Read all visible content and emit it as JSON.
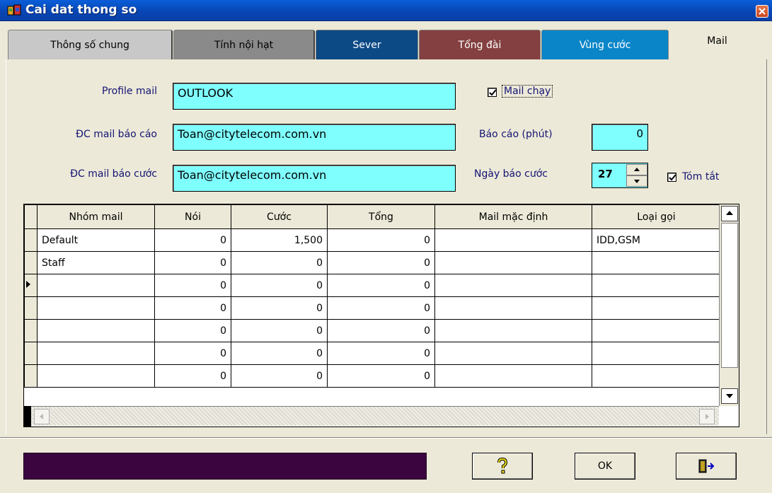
{
  "window": {
    "title": "Cai dat thong so"
  },
  "tabs": [
    {
      "label": "Thông số chung"
    },
    {
      "label": "Tính nội hạt"
    },
    {
      "label": "Sever"
    },
    {
      "label": "Tổng đài"
    },
    {
      "label": "Vùng cước"
    },
    {
      "label": "Mail"
    }
  ],
  "form": {
    "profile_label": "Profile mail",
    "profile_value": "OUTLOOK",
    "report_mail_label": "ĐC mail báo cáo",
    "report_mail_value": "Toan@citytelecom.com.vn",
    "billing_mail_label": "ĐC mail báo cước",
    "billing_mail_value": "Toan@citytelecom.com.vn",
    "mail_running_label": "Mail chạy",
    "mail_running_checked": true,
    "report_minutes_label": "Báo cáo (phút)",
    "report_minutes_value": "0",
    "billing_day_label": "Ngày báo cước",
    "billing_day_value": "27",
    "summary_label": "Tóm tắt",
    "summary_checked": true
  },
  "grid": {
    "columns": [
      "Nhóm mail",
      "Nói",
      "Cước",
      "Tổng",
      "Mail mặc định",
      "Loại gọi"
    ],
    "rows": [
      [
        "Default",
        "0",
        "1,500",
        "0",
        "",
        "IDD,GSM"
      ],
      [
        "Staff",
        "0",
        "0",
        "0",
        "",
        ""
      ],
      [
        "",
        "0",
        "0",
        "0",
        "",
        ""
      ],
      [
        "",
        "0",
        "0",
        "0",
        "",
        ""
      ],
      [
        "",
        "0",
        "0",
        "0",
        "",
        ""
      ],
      [
        "",
        "0",
        "0",
        "0",
        "",
        ""
      ],
      [
        "",
        "0",
        "0",
        "0",
        "",
        ""
      ]
    ],
    "current_row": 2
  },
  "buttons": {
    "ok_label": "OK"
  },
  "colors": {
    "input_bg": "#80ffff",
    "status_bar": "#3b0540",
    "label_text": "#141474"
  }
}
